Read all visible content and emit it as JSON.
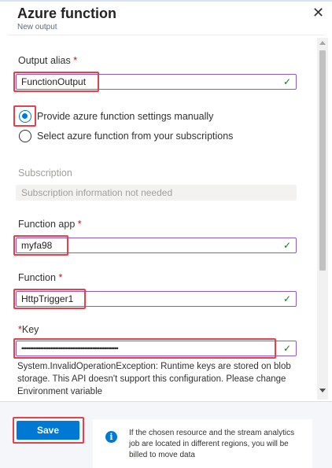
{
  "panel": {
    "title": "Azure function",
    "subtitle": "New output",
    "close_glyph": "✕"
  },
  "form": {
    "output_alias": {
      "label": "Output alias",
      "required_mark": "*",
      "value": "FunctionOutput"
    },
    "mode": {
      "options": [
        {
          "label": "Provide azure function settings manually",
          "selected": true
        },
        {
          "label": "Select azure function from your subscriptions",
          "selected": false
        }
      ]
    },
    "subscription": {
      "label": "Subscription",
      "placeholder": "Subscription information not needed"
    },
    "function_app": {
      "label": "Function app",
      "required_mark": "*",
      "value": "myfa98"
    },
    "function": {
      "label": "Function",
      "required_mark": "*",
      "value": "HttpTrigger1"
    },
    "key": {
      "label": "Key",
      "required_mark": "*",
      "value": "•••••••••••••••••••••••••••••••••••••••••••••••••••••••••"
    },
    "error_message": "System.InvalidOperationException: Runtime keys are stored on blob storage. This API doesn't support this configuration. Please change Environment variable"
  },
  "footer": {
    "save_label": "Save",
    "info_text": "If the chosen resource and the stream analytics job are located in different regions, you will be billed to move data"
  },
  "icons": {
    "check": "✓",
    "info": "i"
  },
  "colors": {
    "accent": "#0078d4",
    "valid_border": "#8a5ec0",
    "valid_check": "#107c10",
    "highlight": "#e0434b"
  }
}
